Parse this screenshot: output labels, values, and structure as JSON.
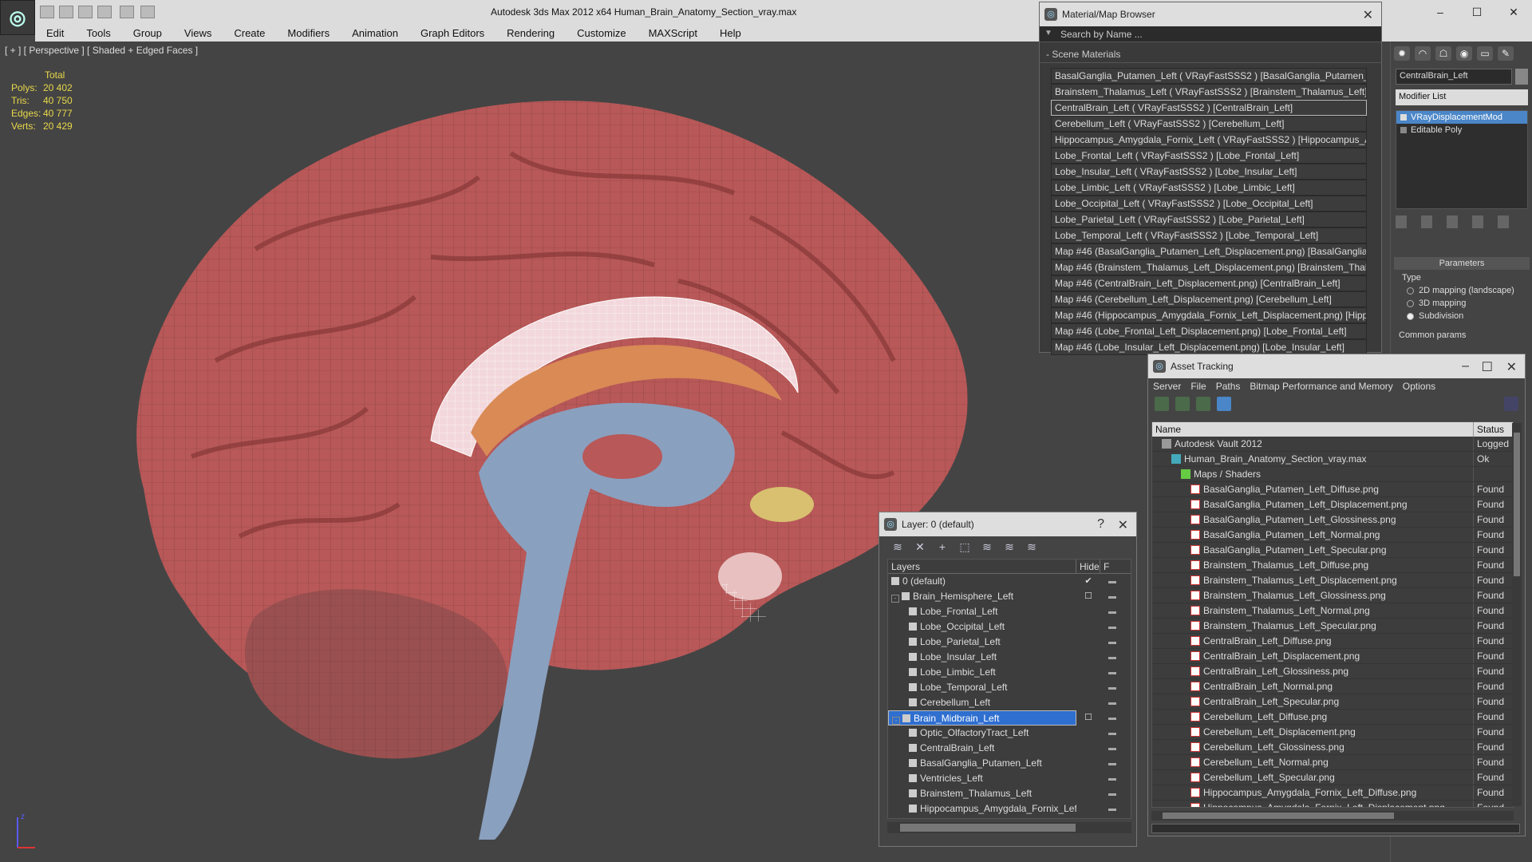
{
  "app": {
    "window_title": "Autodesk 3ds Max  2012 x64      Human_Brain_Anatomy_Section_vray.max",
    "menu": [
      "Edit",
      "Tools",
      "Group",
      "Views",
      "Create",
      "Modifiers",
      "Animation",
      "Graph Editors",
      "Rendering",
      "Customize",
      "MAXScript",
      "Help"
    ]
  },
  "viewport": {
    "label": "[ + ] [ Perspective ] [ Shaded + Edged Faces ]",
    "stats": {
      "header": "Total",
      "rows": [
        {
          "k": "Polys:",
          "v": "20 402"
        },
        {
          "k": "Tris:",
          "v": "40 750"
        },
        {
          "k": "Edges:",
          "v": "40 777"
        },
        {
          "k": "Verts:",
          "v": "20 429"
        }
      ]
    }
  },
  "material_browser": {
    "title": "Material/Map Browser",
    "search_placeholder": "Search by Name ...",
    "section": "- Scene Materials",
    "items": [
      "BasalGanglia_Putamen_Left  ( VRayFastSSS2 )  [BasalGanglia_Putamen_Le...",
      "Brainstem_Thalamus_Left  ( VRayFastSSS2 )  [Brainstem_Thalamus_Left]",
      "CentralBrain_Left  ( VRayFastSSS2 )  [CentralBrain_Left]",
      "Cerebellum_Left  ( VRayFastSSS2 )  [Cerebellum_Left]",
      "Hippocampus_Amygdala_Fornix_Left  ( VRayFastSSS2 )  [Hippocampus_A...",
      "Lobe_Frontal_Left  ( VRayFastSSS2 )  [Lobe_Frontal_Left]",
      "Lobe_Insular_Left  ( VRayFastSSS2 )  [Lobe_Insular_Left]",
      "Lobe_Limbic_Left  ( VRayFastSSS2 )  [Lobe_Limbic_Left]",
      "Lobe_Occipital_Left  ( VRayFastSSS2 )  [Lobe_Occipital_Left]",
      "Lobe_Parietal_Left  ( VRayFastSSS2 )  [Lobe_Parietal_Left]",
      "Lobe_Temporal_Left  ( VRayFastSSS2 )  [Lobe_Temporal_Left]",
      "Map #46 (BasalGanglia_Putamen_Left_Displacement.png) [BasalGanglia_...",
      "Map #46 (Brainstem_Thalamus_Left_Displacement.png)  [Brainstem_Thal...",
      "Map #46 (CentralBrain_Left_Displacement.png)  [CentralBrain_Left]",
      "Map #46 (Cerebellum_Left_Displacement.png)  [Cerebellum_Left]",
      "Map #46 (Hippocampus_Amygdala_Fornix_Left_Displacement.png) [Hipp...",
      "Map #46 (Lobe_Frontal_Left_Displacement.png)  [Lobe_Frontal_Left]",
      "Map #46 (Lobe_Insular_Left_Displacement.png)  [Lobe_Insular_Left]"
    ],
    "selected_index": 2
  },
  "command_panel": {
    "object_name": "CentralBrain_Left",
    "modifier_list": "Modifier List",
    "stack": [
      "VRayDisplacementMod",
      "Editable Poly"
    ],
    "parameters_header": "Parameters",
    "type_label": "Type",
    "options": [
      "2D mapping (landscape)",
      "3D mapping",
      "Subdivision"
    ],
    "selected_option": 2,
    "common_params": "Common params"
  },
  "asset_tracking": {
    "title": "Asset Tracking",
    "menu": [
      "Server",
      "File",
      "Paths",
      "Bitmap Performance and Memory",
      "Options"
    ],
    "columns": {
      "name": "Name",
      "status": "Status"
    },
    "rows": [
      {
        "name": "Autodesk Vault 2012",
        "status": "Logged",
        "indent": 1,
        "icon": "vault"
      },
      {
        "name": "Human_Brain_Anatomy_Section_vray.max",
        "status": "Ok",
        "indent": 2,
        "icon": "max"
      },
      {
        "name": "Maps / Shaders",
        "status": "",
        "indent": 3,
        "icon": "folder"
      },
      {
        "name": "BasalGanglia_Putamen_Left_Diffuse.png",
        "status": "Found",
        "indent": 4,
        "icon": "png"
      },
      {
        "name": "BasalGanglia_Putamen_Left_Displacement.png",
        "status": "Found",
        "indent": 4,
        "icon": "png"
      },
      {
        "name": "BasalGanglia_Putamen_Left_Glossiness.png",
        "status": "Found",
        "indent": 4,
        "icon": "png"
      },
      {
        "name": "BasalGanglia_Putamen_Left_Normal.png",
        "status": "Found",
        "indent": 4,
        "icon": "png"
      },
      {
        "name": "BasalGanglia_Putamen_Left_Specular.png",
        "status": "Found",
        "indent": 4,
        "icon": "png"
      },
      {
        "name": "Brainstem_Thalamus_Left_Diffuse.png",
        "status": "Found",
        "indent": 4,
        "icon": "png"
      },
      {
        "name": "Brainstem_Thalamus_Left_Displacement.png",
        "status": "Found",
        "indent": 4,
        "icon": "png"
      },
      {
        "name": "Brainstem_Thalamus_Left_Glossiness.png",
        "status": "Found",
        "indent": 4,
        "icon": "png"
      },
      {
        "name": "Brainstem_Thalamus_Left_Normal.png",
        "status": "Found",
        "indent": 4,
        "icon": "png"
      },
      {
        "name": "Brainstem_Thalamus_Left_Specular.png",
        "status": "Found",
        "indent": 4,
        "icon": "png"
      },
      {
        "name": "CentralBrain_Left_Diffuse.png",
        "status": "Found",
        "indent": 4,
        "icon": "png"
      },
      {
        "name": "CentralBrain_Left_Displacement.png",
        "status": "Found",
        "indent": 4,
        "icon": "png"
      },
      {
        "name": "CentralBrain_Left_Glossiness.png",
        "status": "Found",
        "indent": 4,
        "icon": "png"
      },
      {
        "name": "CentralBrain_Left_Normal.png",
        "status": "Found",
        "indent": 4,
        "icon": "png"
      },
      {
        "name": "CentralBrain_Left_Specular.png",
        "status": "Found",
        "indent": 4,
        "icon": "png"
      },
      {
        "name": "Cerebellum_Left_Diffuse.png",
        "status": "Found",
        "indent": 4,
        "icon": "png"
      },
      {
        "name": "Cerebellum_Left_Displacement.png",
        "status": "Found",
        "indent": 4,
        "icon": "png"
      },
      {
        "name": "Cerebellum_Left_Glossiness.png",
        "status": "Found",
        "indent": 4,
        "icon": "png"
      },
      {
        "name": "Cerebellum_Left_Normal.png",
        "status": "Found",
        "indent": 4,
        "icon": "png"
      },
      {
        "name": "Cerebellum_Left_Specular.png",
        "status": "Found",
        "indent": 4,
        "icon": "png"
      },
      {
        "name": "Hippocampus_Amygdala_Fornix_Left_Diffuse.png",
        "status": "Found",
        "indent": 4,
        "icon": "png"
      },
      {
        "name": "Hippocampus_Amygdala_Fornix_Left_Displacement.png",
        "status": "Found",
        "indent": 4,
        "icon": "png"
      }
    ]
  },
  "layers": {
    "title": "Layer: 0 (default)",
    "help": "?",
    "columns": {
      "name": "Layers",
      "hide": "Hide",
      "freeze": "F"
    },
    "rows": [
      {
        "name": "0 (default)",
        "level": 0,
        "expander": "",
        "hide": "✔",
        "sel": false
      },
      {
        "name": "Brain_Hemisphere_Left",
        "level": 0,
        "expander": "-",
        "hide": "☐",
        "sel": false
      },
      {
        "name": "Lobe_Frontal_Left",
        "level": 1,
        "expander": "",
        "hide": "",
        "sel": false
      },
      {
        "name": "Lobe_Occipital_Left",
        "level": 1,
        "expander": "",
        "hide": "",
        "sel": false
      },
      {
        "name": "Lobe_Parietal_Left",
        "level": 1,
        "expander": "",
        "hide": "",
        "sel": false
      },
      {
        "name": "Lobe_Insular_Left",
        "level": 1,
        "expander": "",
        "hide": "",
        "sel": false
      },
      {
        "name": "Lobe_Limbic_Left",
        "level": 1,
        "expander": "",
        "hide": "",
        "sel": false
      },
      {
        "name": "Lobe_Temporal_Left",
        "level": 1,
        "expander": "",
        "hide": "",
        "sel": false
      },
      {
        "name": "Cerebellum_Left",
        "level": 1,
        "expander": "",
        "hide": "",
        "sel": false
      },
      {
        "name": "Brain_Midbrain_Left",
        "level": 0,
        "expander": "-",
        "hide": "☐",
        "sel": true
      },
      {
        "name": "Optic_OlfactoryTract_Left",
        "level": 1,
        "expander": "",
        "hide": "",
        "sel": false
      },
      {
        "name": "CentralBrain_Left",
        "level": 1,
        "expander": "",
        "hide": "",
        "sel": false
      },
      {
        "name": "BasalGanglia_Putamen_Left",
        "level": 1,
        "expander": "",
        "hide": "",
        "sel": false
      },
      {
        "name": "Ventricles_Left",
        "level": 1,
        "expander": "",
        "hide": "",
        "sel": false
      },
      {
        "name": "Brainstem_Thalamus_Left",
        "level": 1,
        "expander": "",
        "hide": "",
        "sel": false
      },
      {
        "name": "Hippocampus_Amygdala_Fornix_Left",
        "level": 1,
        "expander": "",
        "hide": "",
        "sel": false
      }
    ]
  },
  "colors": {
    "selection": "#2f6fd0",
    "stats": "#e8d84a",
    "brain": "#b85a5a"
  }
}
